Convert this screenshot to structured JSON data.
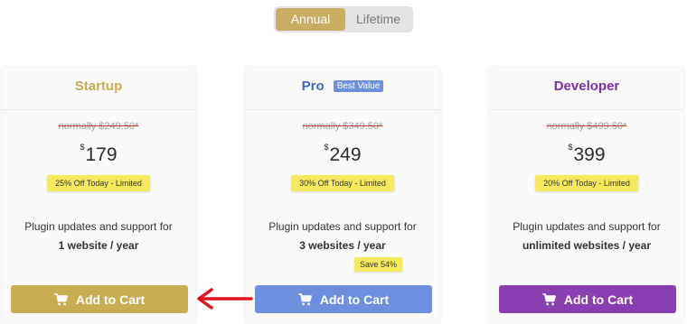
{
  "toggle": {
    "annual": "Annual",
    "lifetime": "Lifetime",
    "selected": "Annual"
  },
  "colors": {
    "startup": "#c9ad52",
    "pro": "#6e8fdb",
    "developer": "#8a3fb0",
    "highlight": "#f5e95e",
    "arrow": "#e0141e"
  },
  "plans": [
    {
      "name": "Startup",
      "normally": "normally $249.50*",
      "currency": "$",
      "price": "179",
      "discount": "25% Off Today - Limited",
      "feature": "Plugin updates and support for",
      "feature_bold": "1 website / year",
      "button": "Add to Cart"
    },
    {
      "name": "Pro",
      "badge": "Best Value",
      "normally": "normally $349.50*",
      "currency": "$",
      "price": "249",
      "discount": "30% Off Today - Limited",
      "feature": "Plugin updates and support for",
      "feature_bold": "3 websites / year",
      "save": "Save 54%",
      "button": "Add to Cart"
    },
    {
      "name": "Developer",
      "normally": "normally $499.50*",
      "currency": "$",
      "price": "399",
      "discount": "20% Off Today - Limited",
      "feature": "Plugin updates and support for",
      "feature_bold": "unlimited websites / year",
      "button": "Add to Cart"
    }
  ],
  "icons": {
    "cart": "cart-icon",
    "arrow": "arrow-left-icon"
  }
}
